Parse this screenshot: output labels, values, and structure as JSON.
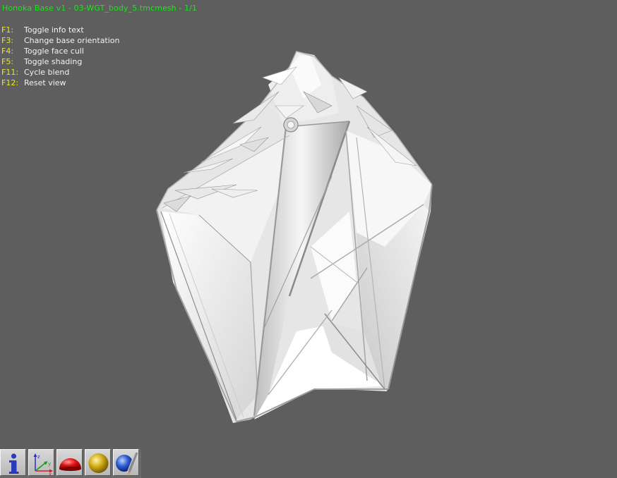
{
  "viewer": {
    "title": "Honoka Base v1 - 03-WGT_body_5.tmcmesh - 1/1",
    "help": [
      {
        "key": "F1:",
        "action": "Toggle info text"
      },
      {
        "key": "F3:",
        "action": "Change base orientation"
      },
      {
        "key": "F4:",
        "action": "Toggle face cull"
      },
      {
        "key": "F5:",
        "action": "Toggle shading"
      },
      {
        "key": "F11:",
        "action": "Cycle blend"
      },
      {
        "key": "F12:",
        "action": "Reset view"
      }
    ]
  },
  "toolbar": {
    "buttons": [
      {
        "icon": "info-icon"
      },
      {
        "icon": "axes-icon"
      },
      {
        "icon": "red-hemisphere-icon"
      },
      {
        "icon": "gold-sphere-icon"
      },
      {
        "icon": "blue-sphere-brush-icon"
      }
    ]
  },
  "colors": {
    "background": "#5e5e5e",
    "title": "#18e818",
    "key": "#e8e82a",
    "text": "#f2f2f2"
  }
}
